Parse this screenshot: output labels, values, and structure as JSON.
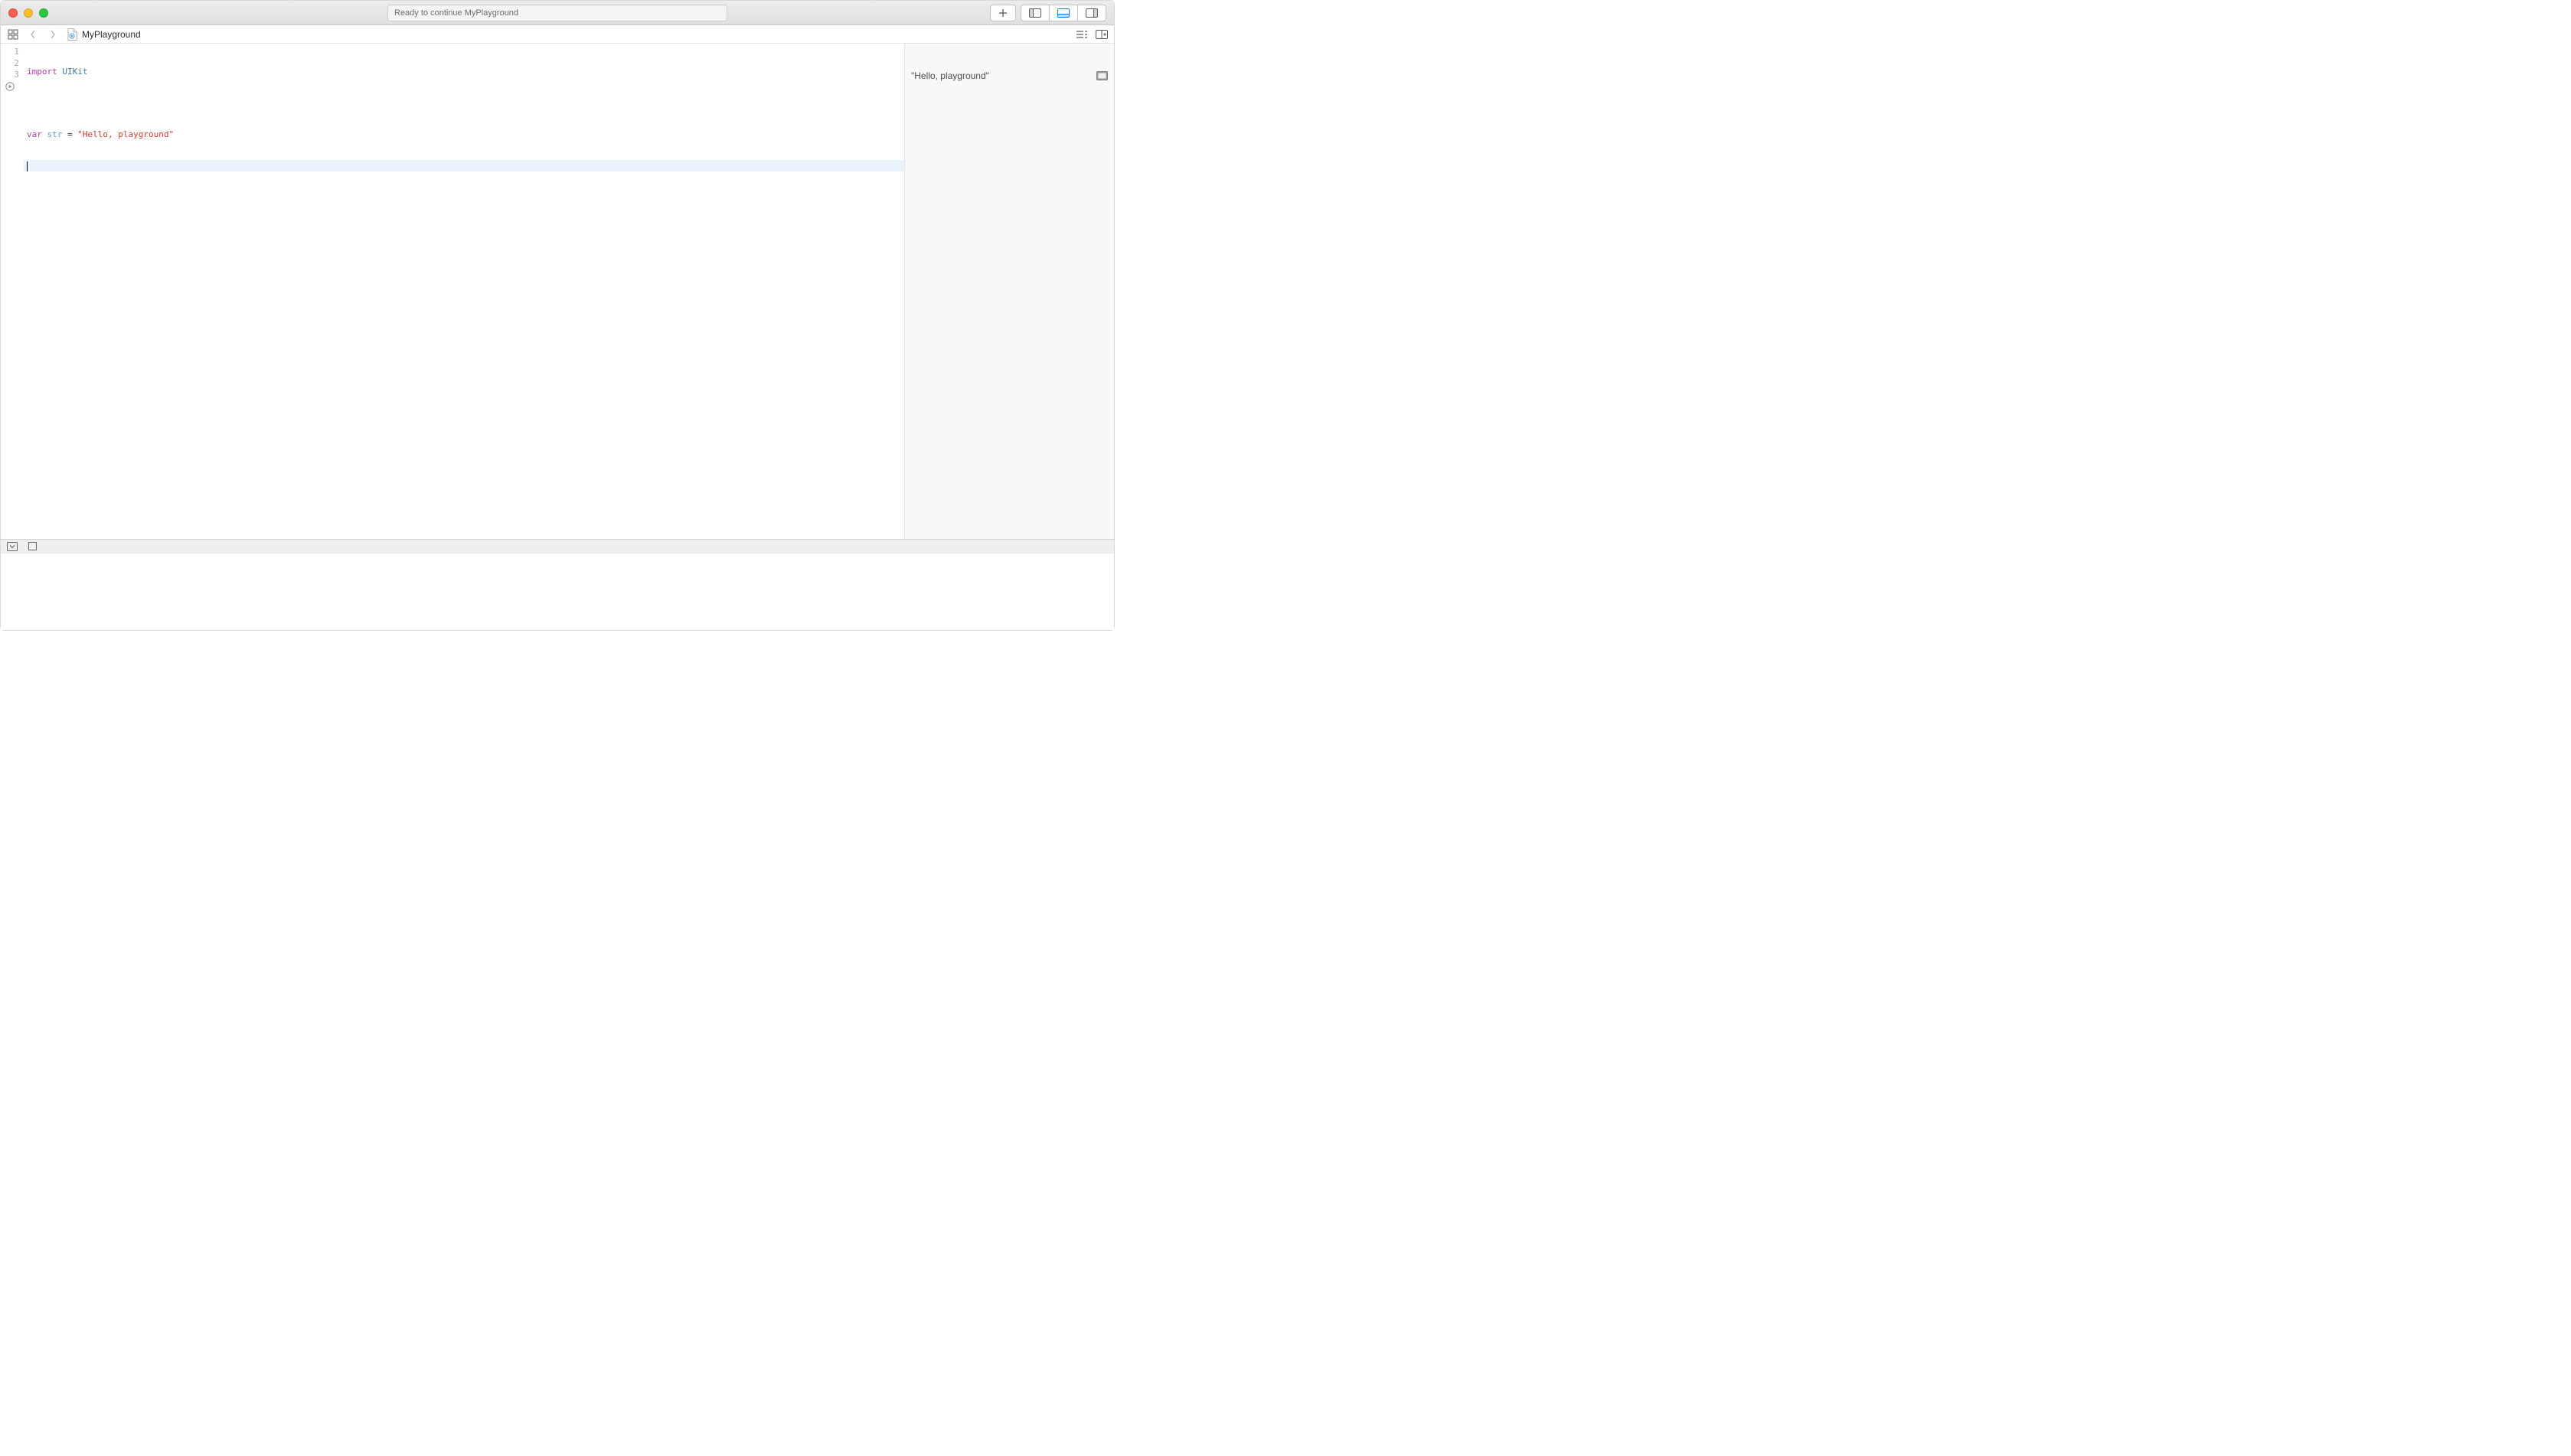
{
  "titlebar": {
    "status_text": "Ready to continue MyPlayground"
  },
  "breadcrumb": {
    "file_name": "MyPlayground"
  },
  "editor": {
    "line_numbers": [
      "1",
      "2",
      "3",
      ""
    ],
    "code": {
      "l1_import": "import",
      "l1_module": " UIKit",
      "l3_var": "var",
      "l3_space1": " ",
      "l3_name": "str",
      "l3_eq": " = ",
      "l3_string": "\"Hello, playground\""
    }
  },
  "results": {
    "r1_value": "\"Hello, playground\""
  }
}
